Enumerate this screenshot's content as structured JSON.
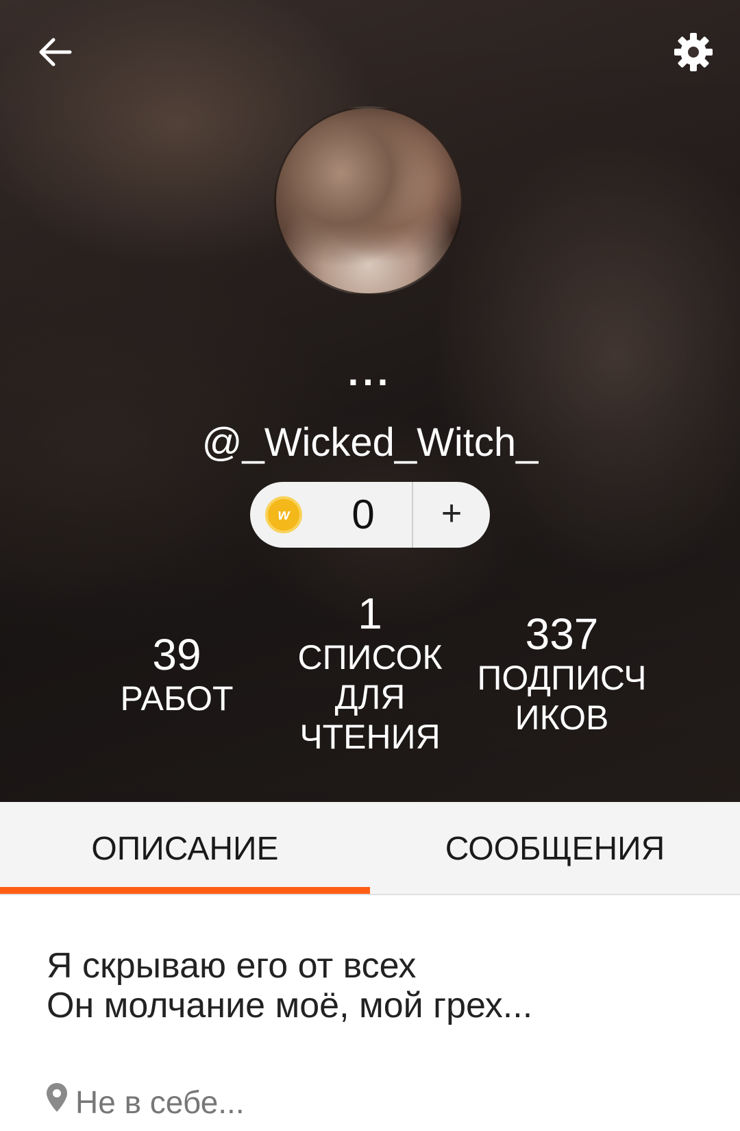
{
  "header": {
    "display_name": "...",
    "username": "@_Wicked_Witch_",
    "back_icon": "arrow-left-icon",
    "settings_icon": "gear-icon"
  },
  "coins": {
    "icon": "wattpad-coin-icon",
    "count": "0",
    "add_label": "+"
  },
  "stats": {
    "works": {
      "value": "39",
      "label": "РАБОТ"
    },
    "reading_lists": {
      "value": "1",
      "label_lines": [
        "СПИСОК",
        "ДЛЯ",
        "ЧТЕНИЯ"
      ]
    },
    "followers": {
      "value": "337",
      "label_lines": [
        "ПОДПИСЧ",
        "ИКОВ"
      ]
    }
  },
  "tabs": [
    {
      "label": "ОПИСАНИЕ",
      "active": true
    },
    {
      "label": "СООБЩЕНИЯ",
      "active": false
    }
  ],
  "about": {
    "lines": [
      "Я скрываю его от всех",
      "Он молчание моё, мой грех..."
    ],
    "location": "Не в себе..."
  },
  "colors": {
    "accent": "#ff5e14",
    "coin": "#f5b81a",
    "tab_bg": "#f5f4f4"
  }
}
